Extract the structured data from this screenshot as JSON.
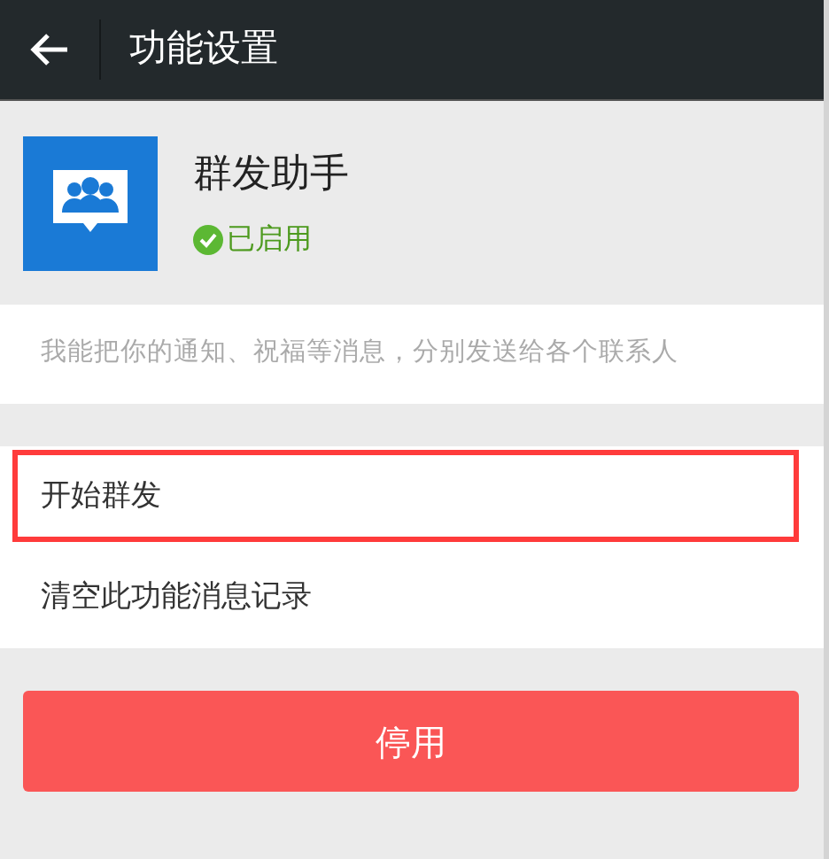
{
  "header": {
    "title": "功能设置"
  },
  "plugin": {
    "name": "群发助手",
    "status": "已启用",
    "enabled": true
  },
  "description": "我能把你的通知、祝福等消息，分别发送给各个联系人",
  "items": [
    {
      "label": "开始群发",
      "highlighted": true
    },
    {
      "label": "清空此功能消息记录",
      "highlighted": false
    }
  ],
  "button": "停用"
}
